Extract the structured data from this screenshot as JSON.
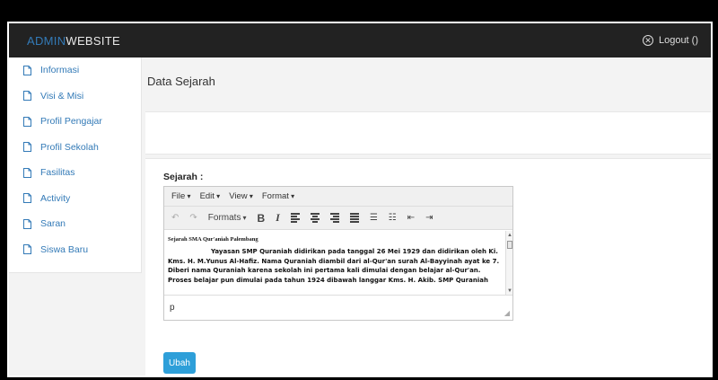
{
  "brand": {
    "part1": "ADMIN",
    "part2": "WEBSITE"
  },
  "header": {
    "logout_label": "Logout ()",
    "logout_icon": "close-circle-icon"
  },
  "sidebar": {
    "items": [
      {
        "label": "Informasi",
        "icon": "file-icon"
      },
      {
        "label": "Visi & Misi",
        "icon": "file-icon"
      },
      {
        "label": "Profil Pengajar",
        "icon": "file-icon"
      },
      {
        "label": "Profil Sekolah",
        "icon": "file-icon"
      },
      {
        "label": "Fasilitas",
        "icon": "file-icon"
      },
      {
        "label": "Activity",
        "icon": "file-icon"
      },
      {
        "label": "Saran",
        "icon": "file-icon"
      },
      {
        "label": "Siswa Baru",
        "icon": "file-icon"
      }
    ]
  },
  "page": {
    "title": "Data Sejarah"
  },
  "form": {
    "label": "Sejarah :",
    "submit_label": "Ubah"
  },
  "editor": {
    "menu": [
      "File",
      "Edit",
      "View",
      "Format"
    ],
    "formats_label": "Formats",
    "bold_label": "B",
    "italic_label": "I",
    "doc_title": "Sejarah SMA Qur'aniah Palembang",
    "paragraph": "Yayasan SMP Quraniah didirikan pada tanggal 26 Mei 1929 dan didirikan  oleh Ki. Kms. H. M.Yunus Al-Hafiz. Nama Quraniah diambil dari al-Qur'an surah Al-Bayyinah ayat ke 7. Diberi nama Quraniah karena sekolah ini pertama kali dimulai dengan belajar al-Qur'an. Proses belajar pun dimulai pada tahun 1924 dibawah langgar Kms. H. Akib. SMP Quraniah",
    "status_path": "p"
  },
  "colors": {
    "topbar": "#222222",
    "accent": "#337ab7",
    "button": "#2e9fd9"
  }
}
